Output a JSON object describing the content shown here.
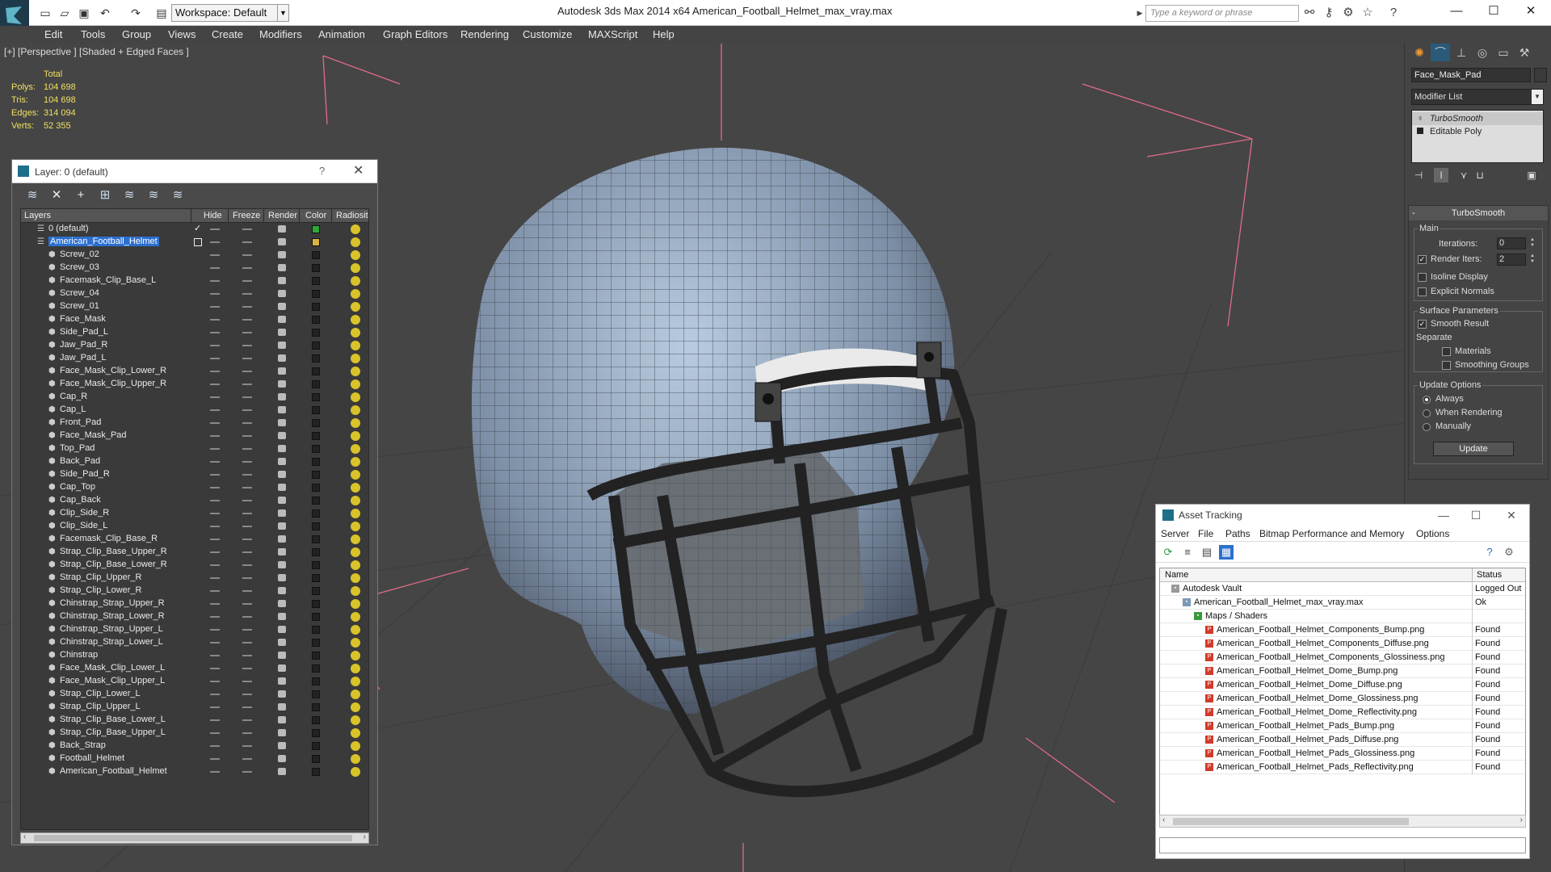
{
  "titlebar": {
    "workspace": "Workspace: Default",
    "title": "Autodesk 3ds Max  2014 x64      American_Football_Helmet_max_vray.max",
    "search_placeholder": "Type a keyword or phrase"
  },
  "menu": [
    "Edit",
    "Tools",
    "Group",
    "Views",
    "Create",
    "Modifiers",
    "Animation",
    "Graph Editors",
    "Rendering",
    "Customize",
    "MAXScript",
    "Help"
  ],
  "viewport": {
    "label": "[+] [Perspective ] [Shaded + Edged Faces ]",
    "stats": {
      "header": "Total",
      "polys_label": "Polys:",
      "polys": "104 698",
      "tris_label": "Tris:",
      "tris": "104 698",
      "edges_label": "Edges:",
      "edges": "314 094",
      "verts_label": "Verts:",
      "verts": "52 355"
    }
  },
  "layer_dialog": {
    "title": "Layer: 0 (default)",
    "help": "?",
    "columns": [
      "Layers",
      "Hide",
      "Freeze",
      "Render",
      "Color",
      "Radiosit"
    ],
    "rows": [
      {
        "name": "0 (default)",
        "level": 0,
        "color": "#2fa83a"
      },
      {
        "name": "American_Football_Helmet",
        "level": 0,
        "color": "#d8b440",
        "selected": true
      },
      {
        "name": "Screw_02",
        "level": 1
      },
      {
        "name": "Screw_03",
        "level": 1
      },
      {
        "name": "Facemask_Clip_Base_L",
        "level": 1
      },
      {
        "name": "Screw_04",
        "level": 1
      },
      {
        "name": "Screw_01",
        "level": 1
      },
      {
        "name": "Face_Mask",
        "level": 1
      },
      {
        "name": "Side_Pad_L",
        "level": 1
      },
      {
        "name": "Jaw_Pad_R",
        "level": 1
      },
      {
        "name": "Jaw_Pad_L",
        "level": 1
      },
      {
        "name": "Face_Mask_Clip_Lower_R",
        "level": 1
      },
      {
        "name": "Face_Mask_Clip_Upper_R",
        "level": 1
      },
      {
        "name": "Cap_R",
        "level": 1
      },
      {
        "name": "Cap_L",
        "level": 1
      },
      {
        "name": "Front_Pad",
        "level": 1
      },
      {
        "name": "Face_Mask_Pad",
        "level": 1
      },
      {
        "name": "Top_Pad",
        "level": 1
      },
      {
        "name": "Back_Pad",
        "level": 1
      },
      {
        "name": "Side_Pad_R",
        "level": 1
      },
      {
        "name": "Cap_Top",
        "level": 1
      },
      {
        "name": "Cap_Back",
        "level": 1
      },
      {
        "name": "Clip_Side_R",
        "level": 1
      },
      {
        "name": "Clip_Side_L",
        "level": 1
      },
      {
        "name": "Facemask_Clip_Base_R",
        "level": 1
      },
      {
        "name": "Strap_Clip_Base_Upper_R",
        "level": 1
      },
      {
        "name": "Strap_Clip_Base_Lower_R",
        "level": 1
      },
      {
        "name": "Strap_Clip_Upper_R",
        "level": 1
      },
      {
        "name": "Strap_Clip_Lower_R",
        "level": 1
      },
      {
        "name": "Chinstrap_Strap_Upper_R",
        "level": 1
      },
      {
        "name": "Chinstrap_Strap_Lower_R",
        "level": 1
      },
      {
        "name": "Chinstrap_Strap_Upper_L",
        "level": 1
      },
      {
        "name": "Chinstrap_Strap_Lower_L",
        "level": 1
      },
      {
        "name": "Chinstrap",
        "level": 1
      },
      {
        "name": "Face_Mask_Clip_Lower_L",
        "level": 1
      },
      {
        "name": "Face_Mask_Clip_Upper_L",
        "level": 1
      },
      {
        "name": "Strap_Clip_Lower_L",
        "level": 1
      },
      {
        "name": "Strap_Clip_Upper_L",
        "level": 1
      },
      {
        "name": "Strap_Clip_Base_Lower_L",
        "level": 1
      },
      {
        "name": "Strap_Clip_Base_Upper_L",
        "level": 1
      },
      {
        "name": "Back_Strap",
        "level": 1
      },
      {
        "name": "Football_Helmet",
        "level": 1
      },
      {
        "name": "American_Football_Helmet",
        "level": 1
      }
    ]
  },
  "command_panel": {
    "object_name": "Face_Mask_Pad",
    "modifier_list": "Modifier List",
    "stack": [
      "TurboSmooth",
      "Editable Poly"
    ],
    "turbosmooth": {
      "title": "TurboSmooth",
      "main_label": "Main",
      "iterations_label": "Iterations:",
      "iterations": "0",
      "render_iters_label": "Render Iters:",
      "render_iters": "2",
      "isoline": "Isoline Display",
      "explicit_normals": "Explicit Normals",
      "surface_label": "Surface Parameters",
      "smooth_result": "Smooth Result",
      "separate_label": "Separate",
      "materials": "Materials",
      "smoothing_groups": "Smoothing Groups",
      "update_label": "Update Options",
      "always": "Always",
      "when_rendering": "When Rendering",
      "manually": "Manually",
      "update_button": "Update"
    }
  },
  "asset_tracking": {
    "title": "Asset Tracking",
    "menu": [
      "Server",
      "File",
      "Paths",
      "Bitmap Performance and Memory",
      "Options"
    ],
    "columns": [
      "Name",
      "Status"
    ],
    "rows": [
      {
        "name": "Autodesk Vault",
        "status": "Logged Out",
        "indent": 0,
        "kind": "vault"
      },
      {
        "name": "American_Football_Helmet_max_vray.max",
        "status": "Ok",
        "indent": 1,
        "kind": "max"
      },
      {
        "name": "Maps / Shaders",
        "status": "",
        "indent": 2,
        "kind": "folder"
      },
      {
        "name": "American_Football_Helmet_Components_Bump.png",
        "status": "Found",
        "indent": 3,
        "kind": "png"
      },
      {
        "name": "American_Football_Helmet_Components_Diffuse.png",
        "status": "Found",
        "indent": 3,
        "kind": "png"
      },
      {
        "name": "American_Football_Helmet_Components_Glossiness.png",
        "status": "Found",
        "indent": 3,
        "kind": "png"
      },
      {
        "name": "American_Football_Helmet_Dome_Bump.png",
        "status": "Found",
        "indent": 3,
        "kind": "png"
      },
      {
        "name": "American_Football_Helmet_Dome_Diffuse.png",
        "status": "Found",
        "indent": 3,
        "kind": "png"
      },
      {
        "name": "American_Football_Helmet_Dome_Glossiness.png",
        "status": "Found",
        "indent": 3,
        "kind": "png"
      },
      {
        "name": "American_Football_Helmet_Dome_Reflectivity.png",
        "status": "Found",
        "indent": 3,
        "kind": "png"
      },
      {
        "name": "American_Football_Helmet_Pads_Bump.png",
        "status": "Found",
        "indent": 3,
        "kind": "png"
      },
      {
        "name": "American_Football_Helmet_Pads_Diffuse.png",
        "status": "Found",
        "indent": 3,
        "kind": "png"
      },
      {
        "name": "American_Football_Helmet_Pads_Glossiness.png",
        "status": "Found",
        "indent": 3,
        "kind": "png"
      },
      {
        "name": "American_Football_Helmet_Pads_Reflectivity.png",
        "status": "Found",
        "indent": 3,
        "kind": "png"
      }
    ]
  },
  "colors": {
    "selection": "#2c6fcf",
    "stats_text": "#f0e060",
    "png_badge": "#d23a2a"
  }
}
